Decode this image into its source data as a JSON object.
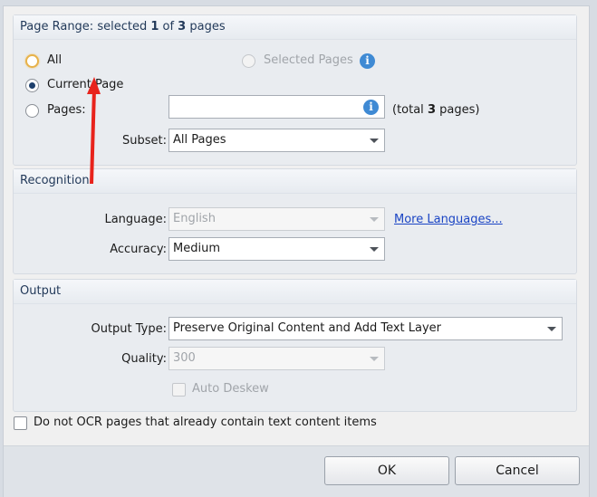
{
  "page_range": {
    "header_prefix": "Page Range: selected ",
    "selected_count": "1",
    "header_mid": " of ",
    "total_count": "3",
    "header_suffix": " pages",
    "all_label": "All",
    "selected_pages_label": "Selected Pages",
    "current_page_label": "Current Page",
    "pages_label": "Pages:",
    "pages_value": "",
    "total_prefix": "(total ",
    "total_count_bold": "3",
    "total_suffix": " pages)",
    "subset_label": "Subset:",
    "subset_value": "All Pages",
    "selected_radio": "Current Page"
  },
  "recognition": {
    "header": "Recognition",
    "language_label": "Language:",
    "language_value": "English",
    "more_languages_link": "More Languages...",
    "accuracy_label": "Accuracy:",
    "accuracy_value": "Medium"
  },
  "output": {
    "header": "Output",
    "output_type_label": "Output Type:",
    "output_type_value": "Preserve Original Content and Add Text Layer",
    "quality_label": "Quality:",
    "quality_value": "300",
    "auto_deskew_label": "Auto Deskew"
  },
  "options": {
    "skip_text_pages_label": "Do not OCR pages that already contain text content items"
  },
  "buttons": {
    "ok": "OK",
    "cancel": "Cancel"
  },
  "icons": {
    "info": "info-icon",
    "annotation_arrow_color": "#e8231c"
  }
}
